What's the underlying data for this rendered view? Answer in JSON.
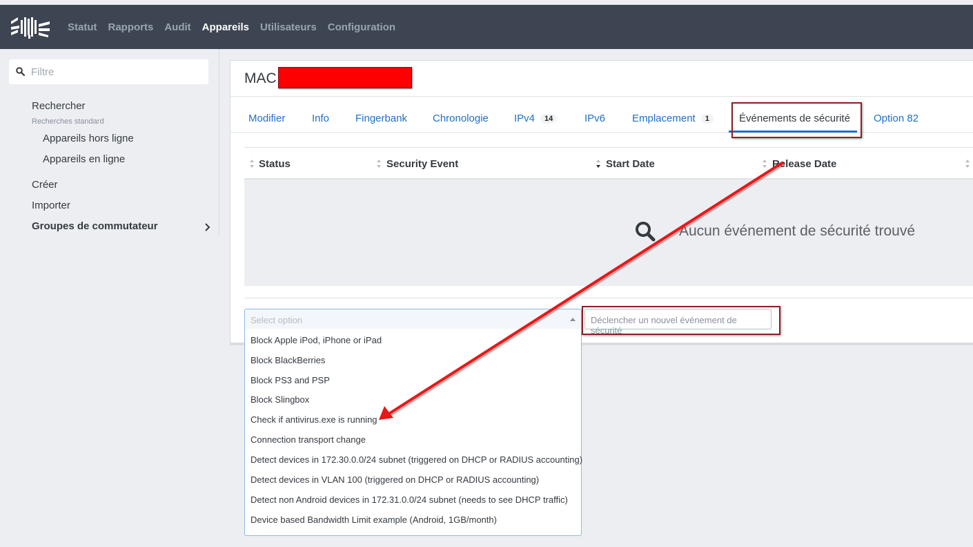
{
  "nav": {
    "logo": "logo",
    "items": [
      "Statut",
      "Rapports",
      "Audit",
      "Appareils",
      "Utilisateurs",
      "Configuration"
    ],
    "active": "Appareils"
  },
  "sidebar": {
    "filter_placeholder": "Filtre",
    "search": "Rechercher",
    "standard_searches": "Recherches standard",
    "offline": "Appareils hors ligne",
    "online": "Appareils en ligne",
    "create": "Créer",
    "import": "Importer",
    "switch_groups": "Groupes de commutateur"
  },
  "device": {
    "title": "MAC"
  },
  "tabs": [
    {
      "label": "Modifier"
    },
    {
      "label": "Info"
    },
    {
      "label": "Fingerbank"
    },
    {
      "label": "Chronologie"
    },
    {
      "label": "IPv4",
      "badge": "14"
    },
    {
      "label": "IPv6"
    },
    {
      "label": "Emplacement",
      "badge": "1"
    },
    {
      "label": "Événements de sécurité"
    },
    {
      "label": "Option 82"
    }
  ],
  "active_tab": "Événements de sécurité",
  "table": {
    "columns": [
      "Status",
      "Security Event",
      "Start Date",
      "Release Date"
    ],
    "sorted_column": "Start Date",
    "empty_message": "Aucun événement de sécurité trouvé"
  },
  "event_select": {
    "placeholder": "Select option",
    "options": [
      "Block Apple iPod, iPhone or iPad",
      "Block BlackBerries",
      "Block PS3 and PSP",
      "Block Slingbox",
      "Check if antivirus.exe is running",
      "Connection transport change",
      "Detect devices in 172.30.0.0/24 subnet (triggered on DHCP or RADIUS accounting)",
      "Detect devices in VLAN 100 (triggered on DHCP or RADIUS accounting)",
      "Detect non Android devices in 172.31.0.0/24 subnet (needs to see DHCP traffic)",
      "Device based Bandwidth Limit example (Android, 1GB/month)"
    ]
  },
  "trigger_button": "Déclencher un nouvel événement de sécurité",
  "colors": {
    "topbar": "#3d4452",
    "link": "#1f6fc5",
    "annotation_red": "#e81818",
    "highlight_border": "#8b1f23",
    "redaction": "#ff0000"
  }
}
